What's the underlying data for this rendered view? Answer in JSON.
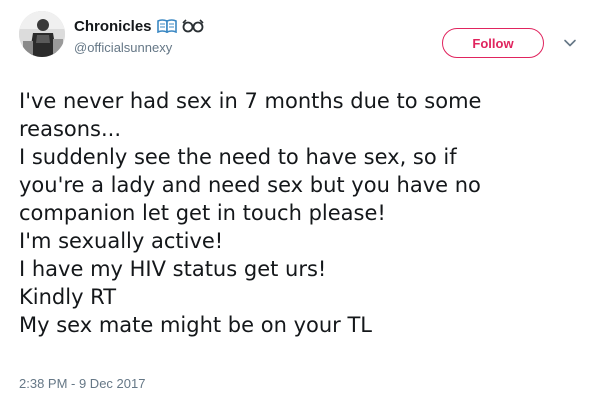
{
  "author": {
    "display_name": "Chronicles",
    "handle": "@officialsunnexy",
    "name_emojis": [
      "open-book-emoji",
      "glasses-emoji"
    ]
  },
  "follow_button": {
    "label": "Follow",
    "color": "#e0245e"
  },
  "more_menu_icon": "chevron-down-icon",
  "tweet": {
    "lines": [
      "I've never had sex in 7 months due to some",
      "reasons...",
      "I suddenly see the need to have sex, so if",
      "you're a lady and need sex but you have no",
      "companion let get in touch please!",
      "I'm sexually active!",
      "I have my HIV status get urs!",
      "Kindly RT",
      "My sex mate might be on your TL"
    ],
    "timestamp": "2:38 PM - 9 Dec 2017"
  },
  "colors": {
    "text": "#14171a",
    "secondary": "#657786",
    "emoji_blue": "#3b88c3"
  }
}
